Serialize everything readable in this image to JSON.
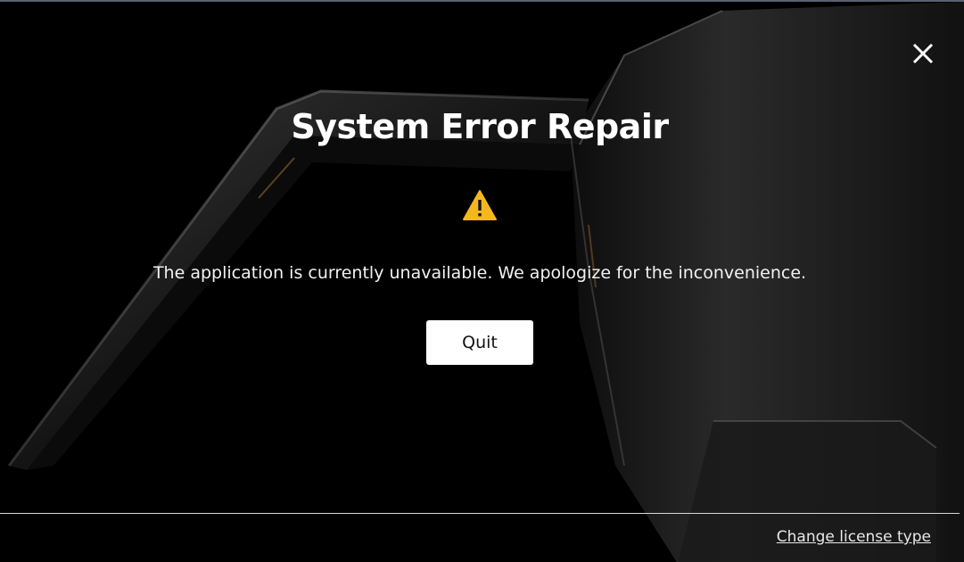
{
  "dialog": {
    "title": "System Error Repair",
    "message": "The application is currently unavailable. We apologize for the inconvenience.",
    "quit_label": "Quit",
    "license_link": "Change license type"
  },
  "icons": {
    "close": "close-icon",
    "warning": "warning-icon"
  },
  "colors": {
    "background": "#000000",
    "warning": "#f5b81c",
    "button_bg": "#ffffff",
    "text": "#ffffff"
  }
}
